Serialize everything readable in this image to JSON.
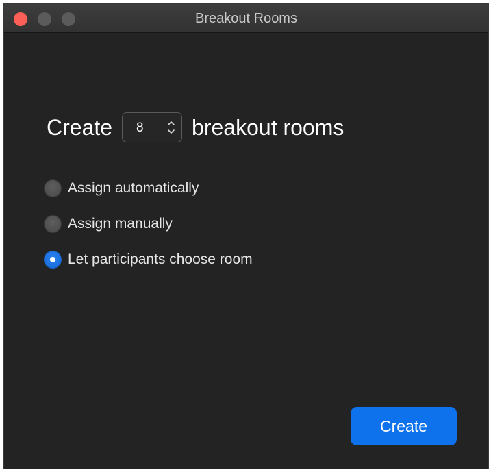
{
  "window": {
    "title": "Breakout Rooms"
  },
  "create_row": {
    "prefix": "Create",
    "room_count": "8",
    "suffix": "breakout rooms"
  },
  "assign_options": [
    {
      "label": "Assign automatically",
      "selected": false
    },
    {
      "label": "Assign manually",
      "selected": false
    },
    {
      "label": "Let participants choose room",
      "selected": true
    }
  ],
  "actions": {
    "create_label": "Create"
  },
  "colors": {
    "accent": "#0e72ed",
    "background": "#232323",
    "close_button": "#fc5f57"
  }
}
